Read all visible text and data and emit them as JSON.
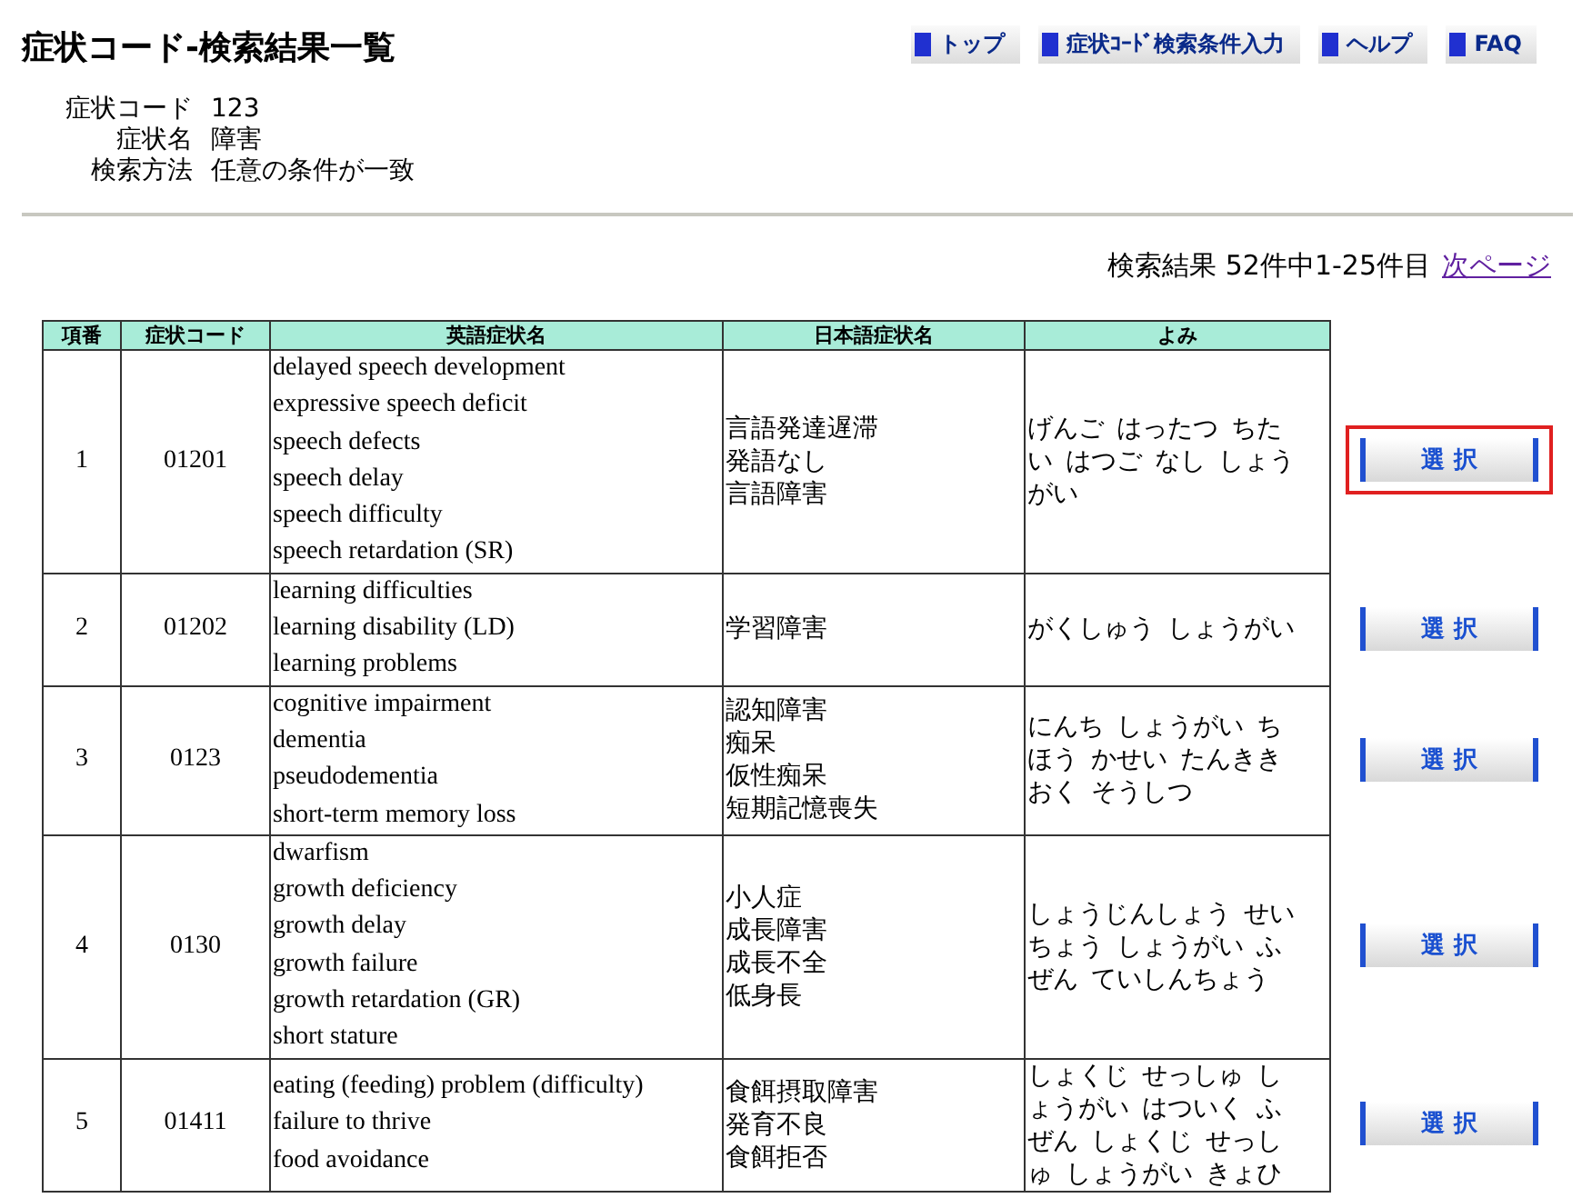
{
  "page": {
    "title": "症状コード-検索結果一覧"
  },
  "nav": [
    {
      "label": "トップ"
    },
    {
      "label": "症状ｺｰﾄﾞ検索条件入力"
    },
    {
      "label": "ヘルプ"
    },
    {
      "label": "FAQ"
    }
  ],
  "conditions": [
    {
      "label": "症状コード",
      "value": "123"
    },
    {
      "label": "症状名",
      "value": "障害"
    },
    {
      "label": "検索方法",
      "value": "任意の条件が一致"
    }
  ],
  "result_summary": {
    "text": "検索結果 52件中1-25件目",
    "next_link": "次ページ"
  },
  "table": {
    "columns": [
      "項番",
      "症状コード",
      "英語症状名",
      "日本語症状名",
      "よみ"
    ],
    "rows": [
      {
        "no": "1",
        "code": "01201",
        "english": [
          "delayed speech development",
          "expressive speech deficit",
          "speech defects",
          "speech delay",
          "speech difficulty",
          "speech retardation (SR)"
        ],
        "japanese": [
          "言語発達遅滞",
          "発語なし",
          "言語障害"
        ],
        "reading": "げんご はったつ ちたい はつご なし しょうがい",
        "button": "選 択",
        "selected": true
      },
      {
        "no": "2",
        "code": "01202",
        "english": [
          "learning difficulties",
          "learning disability (LD)",
          "learning problems"
        ],
        "japanese": [
          "学習障害"
        ],
        "reading": "がくしゅう しょうがい",
        "button": "選 択",
        "selected": false
      },
      {
        "no": "3",
        "code": "0123",
        "english": [
          "cognitive impairment",
          "dementia",
          "pseudodementia",
          "short-term memory loss"
        ],
        "japanese": [
          "認知障害",
          "痴呆",
          "仮性痴呆",
          "短期記憶喪失"
        ],
        "reading": "にんち しょうがい ちほう かせい たんききおく そうしつ",
        "button": "選 択",
        "selected": false
      },
      {
        "no": "4",
        "code": "0130",
        "english": [
          "dwarfism",
          "growth deficiency",
          "growth delay",
          "growth failure",
          "growth retardation (GR)",
          "short stature"
        ],
        "japanese": [
          "小人症",
          "成長障害",
          "成長不全",
          "低身長"
        ],
        "reading": "しょうじんしょう せいちょう しょうがい ふぜん ていしんちょう",
        "button": "選 択",
        "selected": false
      },
      {
        "no": "5",
        "code": "01411",
        "english": [
          "eating (feeding) problem (difficulty)",
          "failure to thrive",
          "food avoidance"
        ],
        "japanese": [
          "食餌摂取障害",
          "発育不良",
          "食餌拒否"
        ],
        "reading": "しょくじ せっしゅ しょうがい はついく ふぜん しょくじ せっしゅ しょうがい きょひ",
        "button": "選 択",
        "selected": false
      }
    ]
  }
}
